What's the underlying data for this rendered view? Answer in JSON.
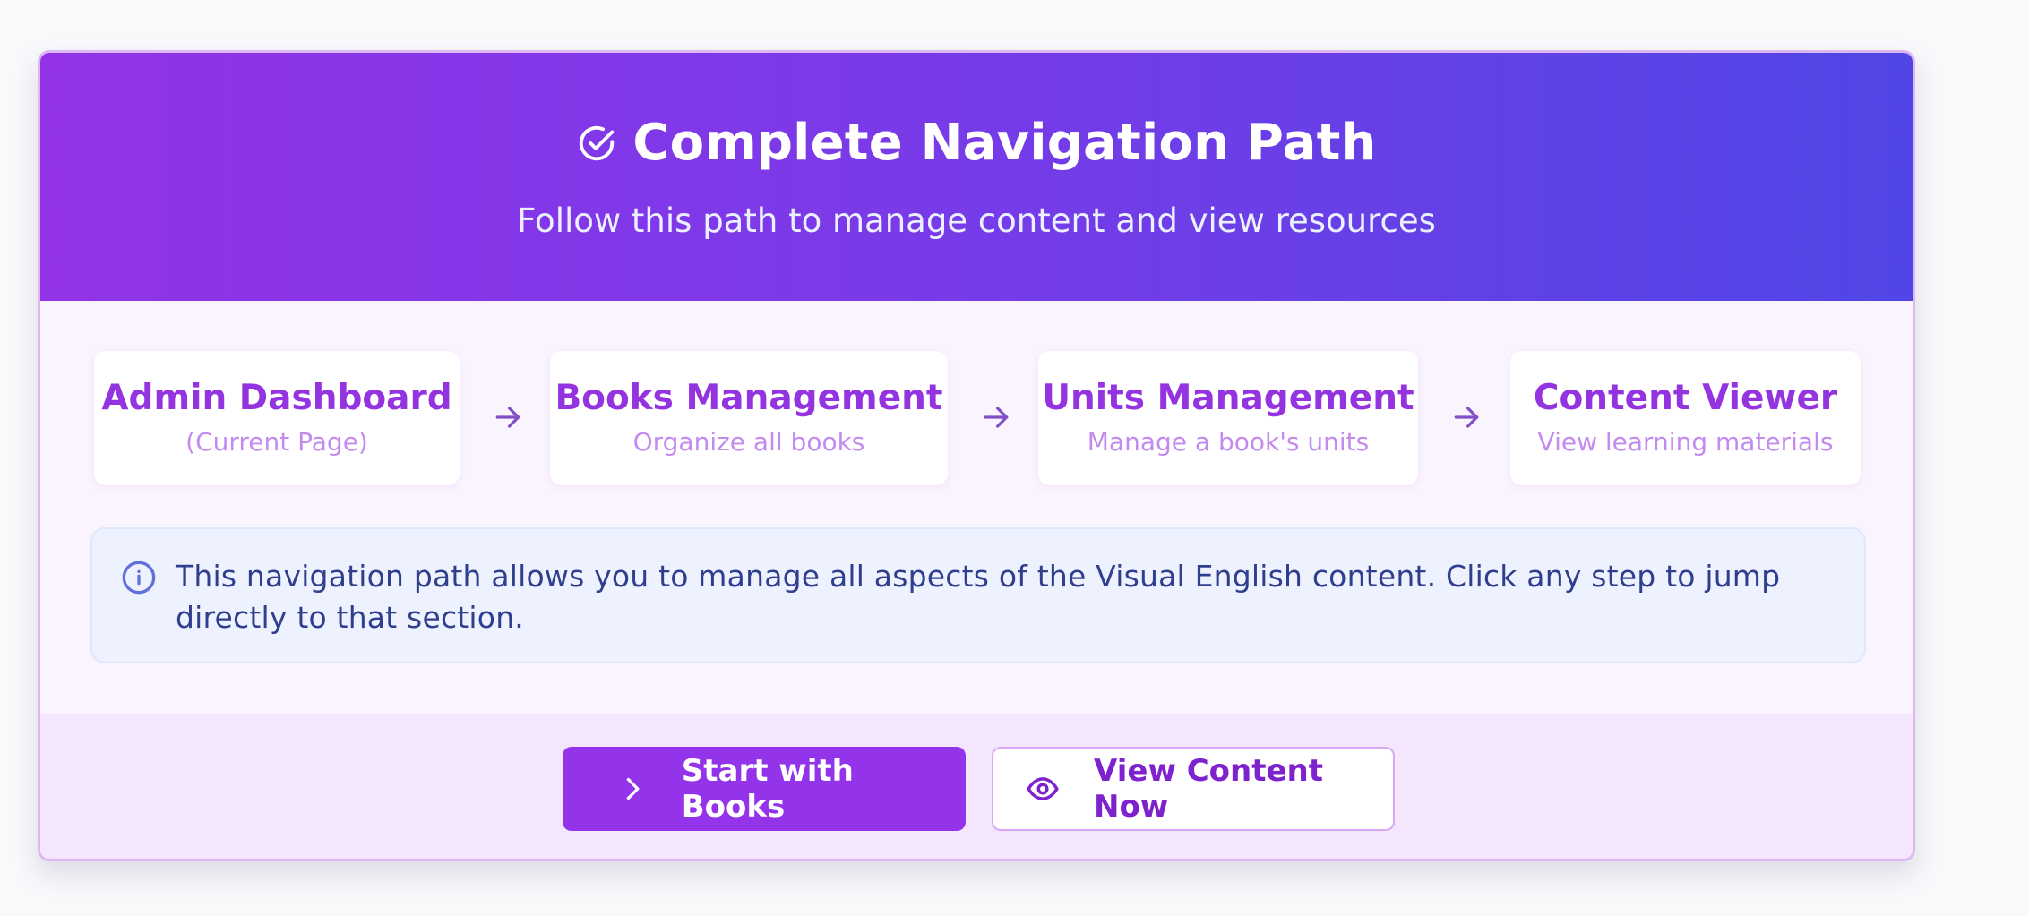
{
  "header": {
    "icon": "circle-check-icon",
    "title": "Complete Navigation Path",
    "subtitle": "Follow this path to manage content and view resources"
  },
  "steps": [
    {
      "title": "Admin Dashboard",
      "subtitle": "(Current Page)"
    },
    {
      "title": "Books Management",
      "subtitle": "Organize all books"
    },
    {
      "title": "Units Management",
      "subtitle": "Manage a book's units"
    },
    {
      "title": "Content Viewer",
      "subtitle": "View learning materials"
    }
  ],
  "step_separator_icon": "arrow-right-icon",
  "info": {
    "icon": "info-icon",
    "text": "This navigation path allows you to manage all aspects of the Visual English content. Click any step to jump directly to that section."
  },
  "actions": {
    "primary": {
      "label": "Start with Books",
      "icon": "chevron-right-icon"
    },
    "secondary": {
      "label": "View Content Now",
      "icon": "eye-icon"
    }
  },
  "colors": {
    "primary": "#9333ea",
    "header_gradient_start": "#9233e7",
    "header_gradient_end": "#5046e5",
    "step_title": "#9433e0",
    "step_subtitle": "#c38bef",
    "info_bg": "#eef2fe",
    "info_text": "#2f3f8d",
    "footer_bg": "#f4e6fd",
    "card_border": "#ddb7f5"
  }
}
